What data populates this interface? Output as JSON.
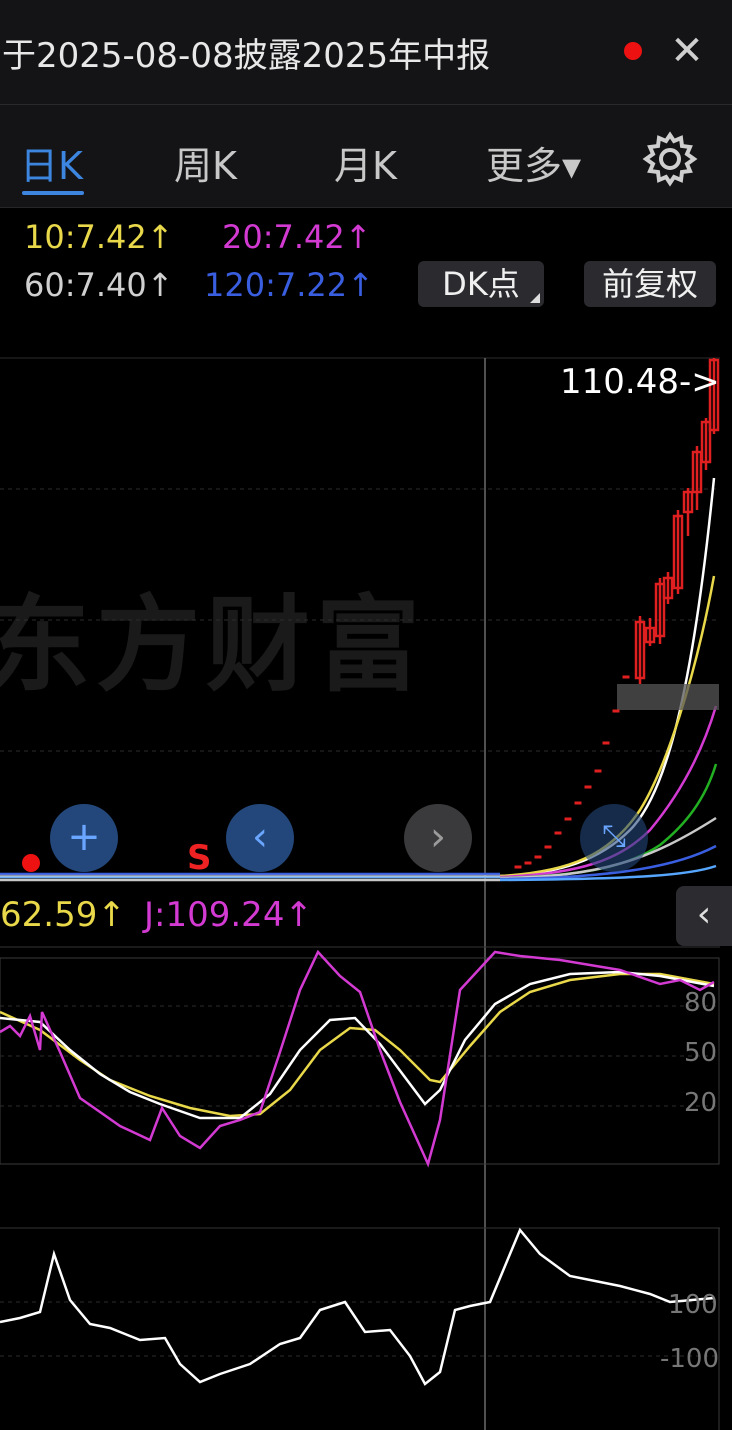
{
  "header": {
    "title": "于2025-08-08披露2025年中报",
    "close_glyph": "✕"
  },
  "tabs": [
    {
      "label": "日K",
      "active": true
    },
    {
      "label": "周K",
      "active": false
    },
    {
      "label": "月K",
      "active": false
    },
    {
      "label": "更多▾",
      "active": false
    }
  ],
  "moving_averages": {
    "ma10": {
      "text": "10:7.42↑",
      "color": "#e8d84a"
    },
    "ma20": {
      "text": "20:7.42↑",
      "color": "#d23ad2"
    },
    "ma60": {
      "text": "60:7.40↑",
      "color": "#d0d0d0"
    },
    "ma120": {
      "text": "120:7.22↑",
      "color": "#3a5ee0"
    }
  },
  "buttons": {
    "dk_point": "DK点",
    "adjust": "前复权"
  },
  "main_chart": {
    "price_label": "110.48->",
    "sell_mark": "S",
    "watermark": "东方财富"
  },
  "nav_buttons": {
    "zoom_in": "+",
    "prev": "‹",
    "next": "›"
  },
  "kdj": {
    "d_value": "62.59↑",
    "j_value": "J:109.24↑",
    "levels": [
      "80",
      "50",
      "20"
    ]
  },
  "lower_indicator": {
    "levels": [
      "100",
      "-100"
    ]
  },
  "collapse_glyph": "‹",
  "icons": [
    "close-icon",
    "gear-icon",
    "plus-icon",
    "chevron-left-icon",
    "chevron-right-icon",
    "expand-icon"
  ],
  "colors": {
    "up": "#e02020",
    "ma_white": "#ffffff",
    "ma_yellow": "#e8d84a",
    "ma_magenta": "#d23ad2",
    "ma_green": "#22b022",
    "ma_gray": "#c8c8c8",
    "ma_blue": "#3a5ee0",
    "active_tab": "#3d86e0"
  }
}
